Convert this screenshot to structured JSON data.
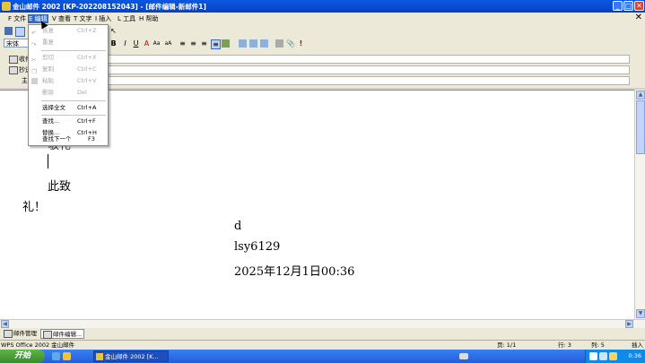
{
  "window": {
    "title": "金山邮件 2002 [KP-202208152043] - [邮件编辑-新邮件1]",
    "minimize_label": "_",
    "maximize_label": "□",
    "close_label": "✕"
  },
  "menubar": {
    "items": [
      {
        "label": "F 文件"
      },
      {
        "label": "E 编辑"
      },
      {
        "label": "V 查看"
      },
      {
        "label": "T 文字"
      },
      {
        "label": "I 插入"
      },
      {
        "label": "L 工具"
      },
      {
        "label": "H 帮助"
      }
    ],
    "close_label": "✕"
  },
  "toolbar": {
    "font_name": "宋体"
  },
  "headers": [
    {
      "label": "收件人"
    },
    {
      "label": "抄送"
    },
    {
      "label": "主题"
    }
  ],
  "edit_menu": {
    "items": [
      {
        "label": "恢复",
        "shortcut": "Ctrl+Z"
      },
      {
        "label": "重复",
        "shortcut": ""
      },
      {
        "label": "剪切",
        "shortcut": "Ctrl+X"
      },
      {
        "label": "复制",
        "shortcut": "Ctrl+C"
      },
      {
        "label": "粘贴",
        "shortcut": "Ctrl+V"
      },
      {
        "label": "删除",
        "shortcut": "Del"
      },
      {
        "label": "选择全文",
        "shortcut": "Ctrl+A"
      },
      {
        "label": "查找...",
        "shortcut": "Ctrl+F"
      },
      {
        "label": "替换...",
        "shortcut": "Ctrl+H"
      },
      {
        "label": "查找下一个",
        "shortcut": "F3"
      }
    ]
  },
  "body": {
    "partial_line": "敬礼",
    "closing1": "此致",
    "closing2": "礼！",
    "sign_name": "d",
    "sign_id": "lsy6129",
    "sign_date": "2025年12月1日00:36"
  },
  "tabs": [
    {
      "label": "邮件管理"
    },
    {
      "label": "邮件编辑..."
    }
  ],
  "statusbar": {
    "app": "WPS Office 2002 金山邮件",
    "page": "页: 1/1",
    "line": "行: 3",
    "col": "列: 5",
    "mode": "插入"
  },
  "taskbar": {
    "start_label": "开始",
    "task_label": "金山邮件 2002 [K...",
    "clock": "0:36"
  }
}
